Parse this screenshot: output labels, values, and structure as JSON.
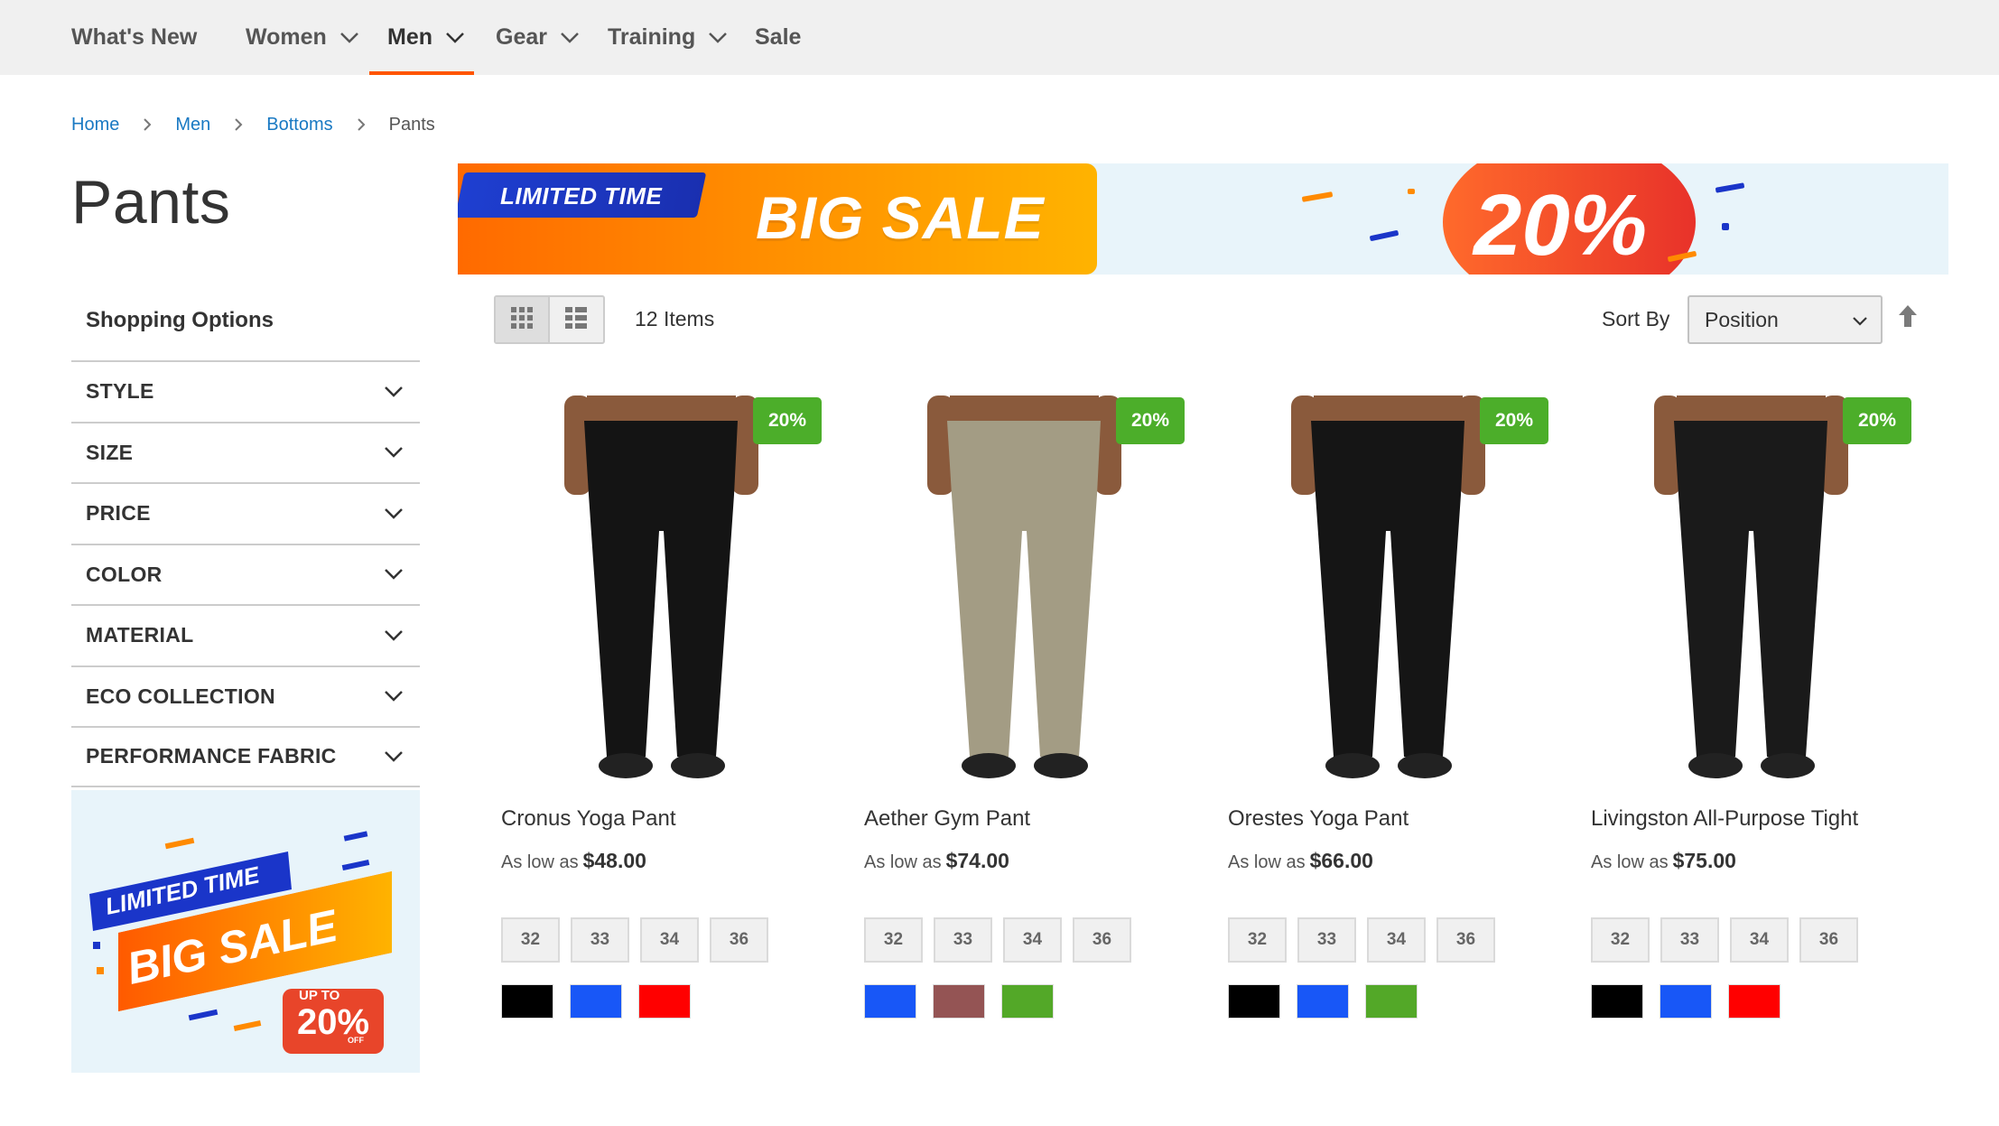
{
  "nav": {
    "items": [
      {
        "label": "What's New",
        "has_dropdown": false
      },
      {
        "label": "Women",
        "has_dropdown": true
      },
      {
        "label": "Men",
        "has_dropdown": true,
        "active": true
      },
      {
        "label": "Gear",
        "has_dropdown": true
      },
      {
        "label": "Training",
        "has_dropdown": true
      },
      {
        "label": "Sale",
        "has_dropdown": false
      }
    ]
  },
  "breadcrumb": {
    "home": "Home",
    "men": "Men",
    "bottoms": "Bottoms",
    "current": "Pants"
  },
  "page_title": "Pants",
  "banner": {
    "limited": "LIMITED TIME",
    "big_sale": "BIG SALE",
    "percent": "20%"
  },
  "sidebar": {
    "title": "Shopping Options",
    "filters": [
      "STYLE",
      "SIZE",
      "PRICE",
      "COLOR",
      "MATERIAL",
      "ECO COLLECTION",
      "PERFORMANCE FABRIC"
    ],
    "banner": {
      "limited": "LIMITED TIME",
      "big_sale": "BIG SALE",
      "up_to": "UP TO",
      "percent": "20%",
      "off": "OFF"
    }
  },
  "toolbar": {
    "item_count": "12 Items",
    "sort_label": "Sort By",
    "sort_value": "Position"
  },
  "colors": {
    "accent": "#ff5501",
    "link": "#1979c3",
    "badge": "#4cae2a"
  },
  "products": [
    {
      "name": "Cronus Yoga Pant",
      "price_prefix": "As low as",
      "price": "$48.00",
      "badge": "20%",
      "sizes": [
        "32",
        "33",
        "34",
        "36"
      ],
      "swatches": [
        "#000000",
        "#1857f7",
        "#ff0000"
      ],
      "pant_color": "#141414"
    },
    {
      "name": "Aether Gym Pant",
      "price_prefix": "As low as",
      "price": "$74.00",
      "badge": "20%",
      "sizes": [
        "32",
        "33",
        "34",
        "36"
      ],
      "swatches": [
        "#1857f7",
        "#945454",
        "#53a828"
      ],
      "pant_color": "#a39c84"
    },
    {
      "name": "Orestes Yoga Pant",
      "price_prefix": "As low as",
      "price": "$66.00",
      "badge": "20%",
      "sizes": [
        "32",
        "33",
        "34",
        "36"
      ],
      "swatches": [
        "#000000",
        "#1857f7",
        "#53a828"
      ],
      "pant_color": "#151515"
    },
    {
      "name": "Livingston All-Purpose Tight",
      "price_prefix": "As low as",
      "price": "$75.00",
      "badge": "20%",
      "sizes": [
        "32",
        "33",
        "34",
        "36"
      ],
      "swatches": [
        "#000000",
        "#1857f7",
        "#ff0000"
      ],
      "pant_color": "#1a1a1a"
    }
  ]
}
